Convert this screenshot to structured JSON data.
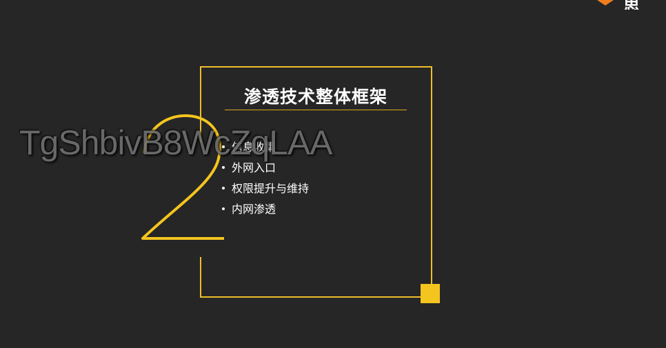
{
  "logo": {
    "text": "思",
    "icon": "logo-mark-icon",
    "color": "#f07d1e"
  },
  "slide": {
    "digit": "2",
    "title": "渗透技术整体框架",
    "bullets": [
      {
        "label": "信息收集"
      },
      {
        "label": "外网入口"
      },
      {
        "label": "权限提升与维持"
      },
      {
        "label": "内网渗透"
      }
    ]
  },
  "watermark": {
    "text": "TgShbivB8WcZqLAA"
  },
  "colors": {
    "background": "#262626",
    "accent": "#f5c51f",
    "frame": "#f0be2d",
    "text": "#ffffff"
  }
}
